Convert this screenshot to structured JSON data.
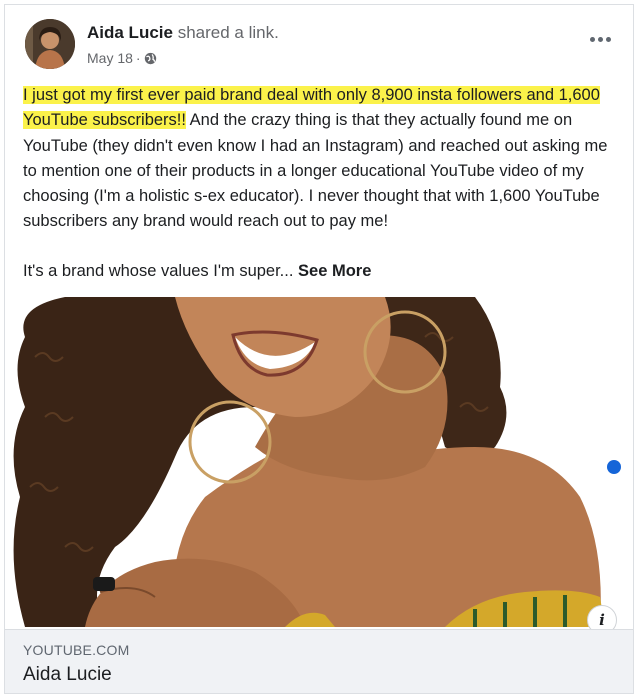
{
  "post": {
    "author_name": "Aida Lucie",
    "author_action": "shared a link.",
    "date": "May 18",
    "date_separator": "·",
    "privacy_icon": "globe-icon",
    "more_icon": "more-options-icon",
    "highlight_color": "#fbf24a",
    "text_highlighted": "I just got my first ever paid brand deal with only 8,900 insta followers and 1,600 YouTube subscribers!!",
    "text_rest": " And the crazy thing is that they actually found me on YouTube (they didn't even know I had an Instagram) and reached out asking me to mention one of their products in a longer educational YouTube video of my choosing (I'm a holistic s-ex educator). I never thought that with 1,600 YouTube subscribers any brand would reach out to pay me!",
    "text_second": "It's a brand whose values I'm super...",
    "see_more": "See More"
  },
  "link_preview": {
    "domain": "YOUTUBE.COM",
    "title": "Aida Lucie",
    "info_label": "i",
    "image_description_icon": "photo-woman-smiling"
  },
  "colors": {
    "text": "#1c1e21",
    "secondary": "#65676b",
    "footer_bg": "#f0f2f5",
    "dot": "#1565d8"
  }
}
